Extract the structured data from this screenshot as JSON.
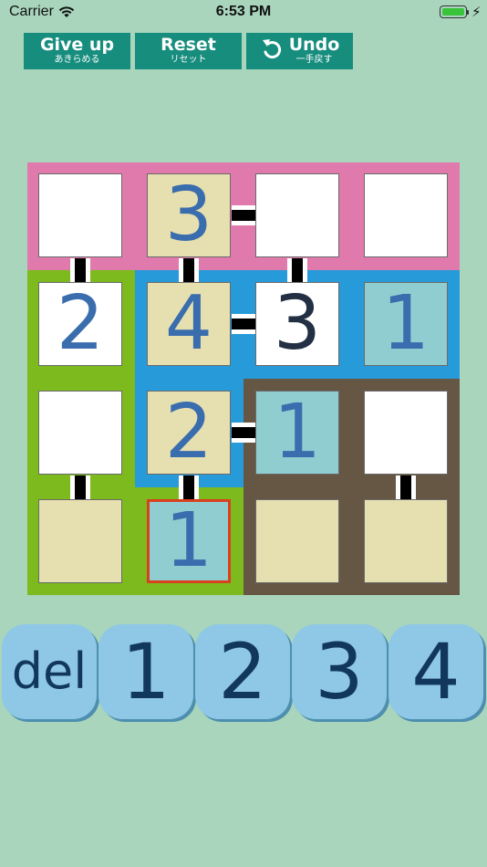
{
  "status_bar": {
    "carrier": "Carrier",
    "time": "6:53 PM",
    "battery": 1.0,
    "wifi_icon": "wifi-icon",
    "battery_icon": "battery-icon",
    "charging_icon": "bolt-icon"
  },
  "toolbar": {
    "give_up": {
      "label": "Give up",
      "sub": "あきらめる"
    },
    "reset": {
      "label": "Reset",
      "sub": "リセット"
    },
    "undo": {
      "label": "Undo",
      "sub": "一手戻す",
      "icon": "undo-icon"
    }
  },
  "colors": {
    "background": "#a8d5bb",
    "button": "#178d7e",
    "region_pink": "#e07aac",
    "region_green": "#7cba1e",
    "region_blue": "#279ad9",
    "region_brown": "#665644",
    "cell_white": "#ffffff",
    "cell_tan": "#e6e0b0",
    "cell_cyan": "#90cdd0",
    "digit_blue": "#3a6dad",
    "digit_dark": "#233043",
    "selection": "#d9401e",
    "key_fill": "#8ec8e6"
  },
  "board": {
    "cells": [
      [
        "",
        "3",
        "",
        ""
      ],
      [
        "2",
        "4",
        "3",
        "1"
      ],
      [
        "",
        "2",
        "1",
        ""
      ],
      [
        "",
        "1",
        "",
        ""
      ]
    ],
    "selected": [
      3,
      1
    ]
  },
  "keypad": {
    "keys": [
      "del",
      "1",
      "2",
      "3",
      "4"
    ]
  }
}
